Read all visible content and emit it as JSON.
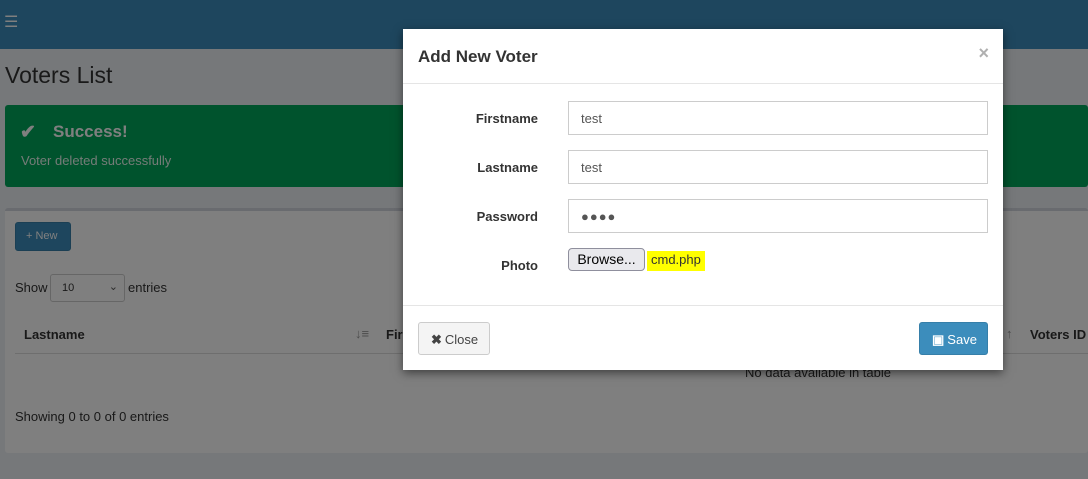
{
  "page": {
    "title": "Voters List",
    "menu_icon": "☰"
  },
  "alert": {
    "icon": "✔",
    "title": "Success!",
    "message": "Voter deleted successfully"
  },
  "toolbar": {
    "new_label": "+ New"
  },
  "table": {
    "show_label": "Show",
    "page_size": "10",
    "entries_label": "entries",
    "columns": [
      "Lastname",
      "Fir",
      "Voters ID"
    ],
    "empty_message": "No data available in table",
    "info": "Showing 0 to 0 of 0 entries"
  },
  "modal": {
    "title": "Add New Voter",
    "close_icon": "×",
    "fields": {
      "firstname_label": "Firstname",
      "firstname_value": "test",
      "lastname_label": "Lastname",
      "lastname_value": "test",
      "password_label": "Password",
      "password_mask": "●●●●",
      "photo_label": "Photo",
      "browse_label": "Browse...",
      "file_name": "cmd.php"
    },
    "footer": {
      "close_label": "Close",
      "save_label": "Save"
    }
  },
  "colors": {
    "header": "#3c8dbc",
    "success": "#00a65a",
    "primary": "#3c8dbc",
    "highlight": "#ffff00"
  }
}
